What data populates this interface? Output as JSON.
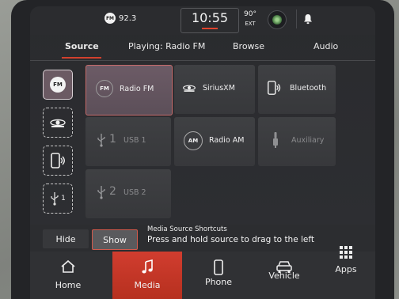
{
  "status_bar": {
    "radio_badge": "FM",
    "radio_freq": "92.3",
    "time": "10:55",
    "temp": "90°",
    "temp_label": "EXT"
  },
  "tabs": [
    {
      "label": "Source",
      "active": true
    },
    {
      "label": "Playing: Radio FM",
      "active": false
    },
    {
      "label": "Browse",
      "active": false
    },
    {
      "label": "Audio",
      "active": false
    }
  ],
  "shortcuts": [
    {
      "icon": "fm-radio-icon",
      "label": "FM"
    },
    {
      "icon": "siriusxm-icon",
      "label": ""
    },
    {
      "icon": "bluetooth-phone-icon",
      "label": ""
    },
    {
      "icon": "usb-icon",
      "label": "1"
    }
  ],
  "sources": {
    "radio_fm": {
      "badge": "FM",
      "label": "Radio FM"
    },
    "siriusxm": {
      "label": "SiriusXM"
    },
    "bluetooth": {
      "label": "Bluetooth"
    },
    "usb1": {
      "number": "1",
      "label": "USB 1"
    },
    "radio_am": {
      "badge": "AM",
      "label": "Radio AM"
    },
    "auxiliary": {
      "label": "Auxiliary"
    },
    "usb2": {
      "number": "2",
      "label": "USB 2"
    }
  },
  "shortcut_bar": {
    "hide_label": "Hide",
    "show_label": "Show",
    "hint_title": "Media Source Shortcuts",
    "hint_text": "Press and hold source to drag to the left"
  },
  "nav": [
    {
      "label": "Home",
      "icon": "home-icon"
    },
    {
      "label": "Media",
      "icon": "music-note-icon",
      "active": true
    },
    {
      "label": "Phone",
      "icon": "phone-icon"
    },
    {
      "label": "Vehicle",
      "icon": "car-icon"
    },
    {
      "label": "Apps",
      "icon": "apps-grid-icon"
    }
  ],
  "colors": {
    "accent": "#d13d2f",
    "selected_tile": "#6c5b66"
  }
}
